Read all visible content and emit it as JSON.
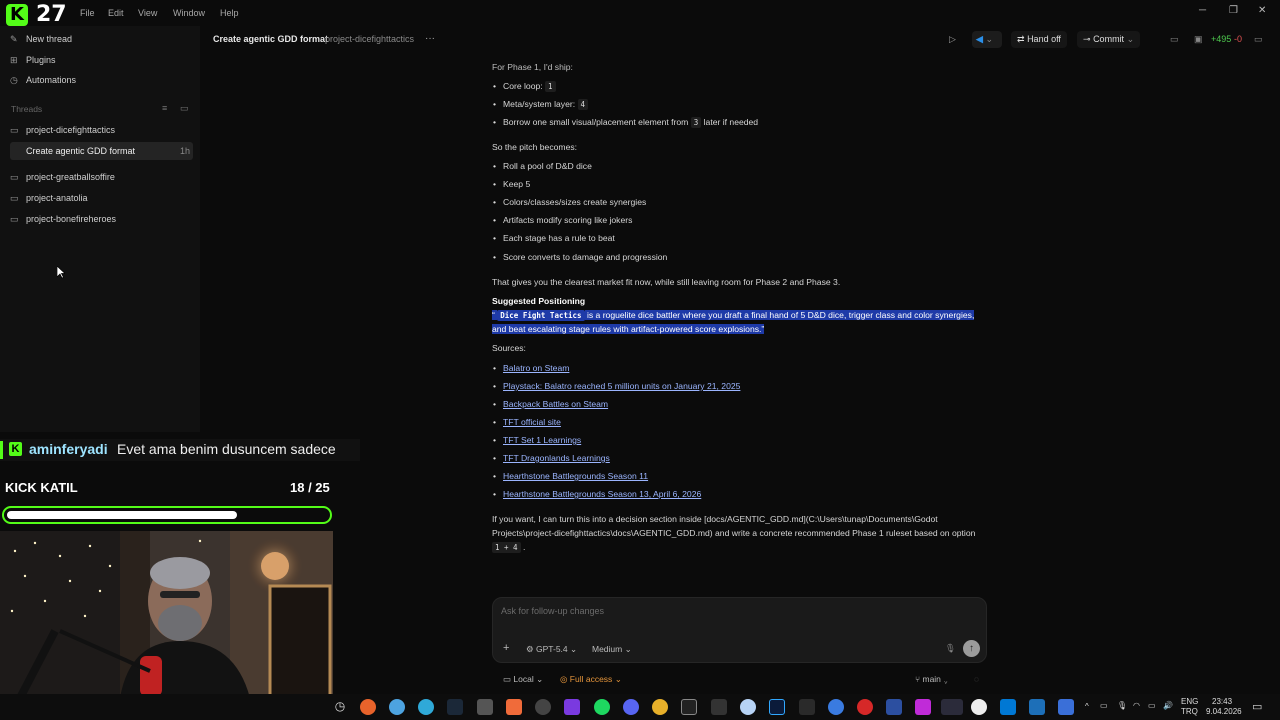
{
  "app": {
    "logo_letter": "K",
    "logo_number": "27",
    "menu": [
      "File",
      "Edit",
      "View",
      "Window",
      "Help"
    ]
  },
  "sidebar": {
    "top_items": [
      {
        "label": "New thread",
        "icon": "edit-icon"
      },
      {
        "label": "Plugins",
        "icon": "plugins-icon"
      },
      {
        "label": "Automations",
        "icon": "clock-icon"
      }
    ],
    "threads_label": "Threads",
    "projects": [
      {
        "label": "project-dicefighttactics"
      },
      {
        "label": "project-greatballsoffire"
      },
      {
        "label": "project-anatolia"
      },
      {
        "label": "project-bonefireheroes"
      }
    ],
    "active_thread": {
      "label": "Create agentic GDD format",
      "age": "1h"
    }
  },
  "header": {
    "title": "Create agentic GDD format",
    "project": "project-dicefighttactics",
    "more": "···",
    "handoff": "Hand off",
    "commit": "Commit",
    "diff_add": "+495",
    "diff_del": "-0"
  },
  "content": {
    "intro": "For Phase 1, I'd ship:",
    "ship": [
      {
        "label": "Core loop:",
        "code": "1"
      },
      {
        "label": "Meta/system layer:",
        "code": "4"
      },
      {
        "label": "Borrow one small visual/placement element from",
        "code": "3",
        "after": "later if needed"
      }
    ],
    "pitch_intro": "So the pitch becomes:",
    "pitch": [
      "Roll a pool of D&D dice",
      "Keep 5",
      "Colors/classes/sizes create synergies",
      "Artifacts modify scoring like jokers",
      "Each stage has a rule to beat",
      "Score converts to damage and progression"
    ],
    "fit": "That gives you the clearest market fit now, while still leaving room for Phase 2 and Phase 3.",
    "positioning_heading": "Suggested Positioning",
    "positioning_open_quote": "“",
    "positioning_code": "Dice Fight Tactics",
    "positioning_line1": "is a roguelite dice battler where you draft a final hand of 5 D&D dice, trigger class and color synergies,",
    "positioning_line2": "and beat escalating stage rules with artifact-powered score explosions.”",
    "sources_label": "Sources:",
    "sources": [
      "Balatro on Steam",
      "Playstack: Balatro reached 5 million units on January 21, 2025",
      "Backpack Battles on Steam",
      "TFT official site",
      "TFT Set 1 Learnings",
      "TFT Dragonlands Learnings",
      "Hearthstone Battlegrounds Season 11",
      "Hearthstone Battlegrounds Season 13, April 6, 2026"
    ],
    "closing_line1": "If you want, I can turn this into a decision section inside [docs/AGENTIC_GDD.md](C:\\Users\\tunap\\Documents\\Godot",
    "closing_line2": "Projects\\project-dicefighttactics\\docs\\AGENTIC_GDD.md) and write a concrete recommended Phase 1 ruleset based on option",
    "closing_code": "1 + 4",
    "closing_end": "."
  },
  "composer": {
    "placeholder": "Ask for follow-up changes",
    "add": "+",
    "model": "GPT-5.4",
    "effort": "Medium",
    "env": "Local",
    "access": "Full access",
    "branch": "main"
  },
  "stream": {
    "chat_user": "aminferyadi",
    "chat_text": "Evet ama benim dusuncem sadece",
    "goal_label": "KICK KATIL",
    "goal_count": "18 / 25",
    "goal_progress": 0.72
  },
  "tray": {
    "lang1": "ENG",
    "lang2": "TRQ",
    "time": "23:43",
    "date": "9.04.2026"
  }
}
